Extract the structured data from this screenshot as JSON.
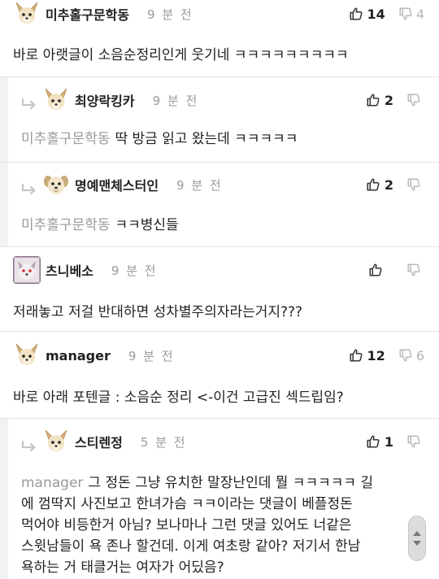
{
  "comments": [
    {
      "name": "미추홀구문학동",
      "time": "9 분 전",
      "up": "14",
      "down": "4",
      "text": "바로 아랫글이 소음순정리인게 웃기네 ㅋㅋㅋㅋㅋㅋㅋㅋㅋ"
    },
    {
      "name": "최양락킹카",
      "time": "9 분 전",
      "up": "2",
      "down": "",
      "mention": "미추홀구문학동",
      "text": "딱 방금 읽고 왔는데 ㅋㅋㅋㅋㅋ"
    },
    {
      "name": "명예맨체스터인",
      "time": "9 분 전",
      "up": "2",
      "down": "",
      "mention": "미추홀구문학동",
      "text": "ㅋㅋ병신들"
    },
    {
      "name": "츠니베소",
      "time": "9 분 전",
      "up": "",
      "down": "",
      "text": "저래놓고 저걸 반대하면 성차별주의자라는거지???"
    },
    {
      "name": "manager",
      "time": "9 분 전",
      "up": "12",
      "down": "6",
      "text": "바로 아래 포텐글 : 소음순 정리 <-이건 고급진 섹드립임?"
    },
    {
      "name": "스티렌정",
      "time": "5 분 전",
      "up": "1",
      "down": "",
      "mention": "manager",
      "text_lines": [
        "그 정돈 그냥 유치한 말장난인데 뭘 ㅋㅋㅋㅋㅋ 길",
        "에 껌딱지 사진보고 한녀가슴 ㅋㅋ이라는 댓글이 베플정돈",
        "먹어야 비등한거 아님? 보나마나 그런 댓글 있어도 너같은",
        "스윗남들이 욕 존나 할건데. 이게 여초랑 같아? 저기서 한남",
        "욕하는 거 태클거는 여자가 어딨음?"
      ]
    }
  ],
  "colors": {
    "reply_bg": "#f2f2f2",
    "muted": "#9a9a9a",
    "divider": "#e3e3e3"
  },
  "icons": {
    "upvote": "thumbs-up-icon",
    "downvote": "thumbs-down-icon",
    "reply": "reply-arrow-icon",
    "avatar": "dog-avatar-icon"
  }
}
